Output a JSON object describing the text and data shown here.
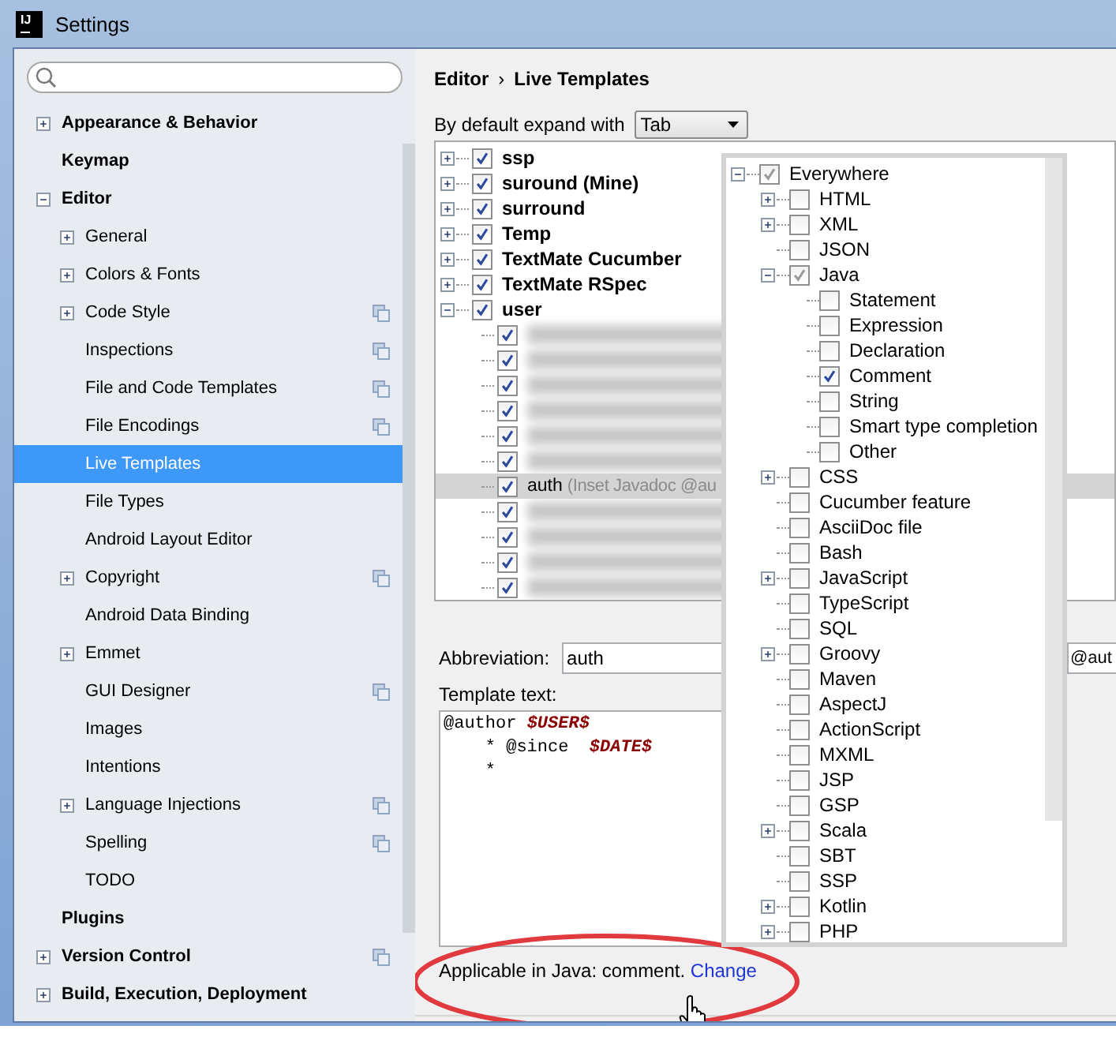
{
  "window": {
    "icon_text": "IJ",
    "title": "Settings"
  },
  "sidebar": {
    "items": [
      {
        "label": "Appearance & Behavior",
        "expanded": false,
        "selected": false,
        "project_level": false
      },
      {
        "label": "Keymap",
        "selected": false,
        "project_level": false
      },
      {
        "label": "Editor",
        "expanded": true,
        "selected": false,
        "project_level": false,
        "children": [
          {
            "label": "General",
            "expanded": false,
            "selected": false,
            "project_level": false
          },
          {
            "label": "Colors & Fonts",
            "expanded": false,
            "selected": false,
            "project_level": false
          },
          {
            "label": "Code Style",
            "expanded": false,
            "selected": false,
            "project_level": true
          },
          {
            "label": "Inspections",
            "selected": false,
            "project_level": true
          },
          {
            "label": "File and Code Templates",
            "selected": false,
            "project_level": true
          },
          {
            "label": "File Encodings",
            "selected": false,
            "project_level": true
          },
          {
            "label": "Live Templates",
            "selected": true,
            "project_level": false
          },
          {
            "label": "File Types",
            "selected": false,
            "project_level": false
          },
          {
            "label": "Android Layout Editor",
            "selected": false,
            "project_level": false
          },
          {
            "label": "Copyright",
            "expanded": false,
            "selected": false,
            "project_level": true
          },
          {
            "label": "Android Data Binding",
            "selected": false,
            "project_level": false
          },
          {
            "label": "Emmet",
            "expanded": false,
            "selected": false,
            "project_level": false
          },
          {
            "label": "GUI Designer",
            "selected": false,
            "project_level": true
          },
          {
            "label": "Images",
            "selected": false,
            "project_level": false
          },
          {
            "label": "Intentions",
            "selected": false,
            "project_level": false
          },
          {
            "label": "Language Injections",
            "expanded": false,
            "selected": false,
            "project_level": true
          },
          {
            "label": "Spelling",
            "selected": false,
            "project_level": true
          },
          {
            "label": "TODO",
            "selected": false,
            "project_level": false
          }
        ]
      },
      {
        "label": "Plugins",
        "selected": false,
        "project_level": false
      },
      {
        "label": "Version Control",
        "expanded": false,
        "selected": false,
        "project_level": true
      },
      {
        "label": "Build, Execution, Deployment",
        "expanded": false,
        "selected": false,
        "project_level": false
      }
    ]
  },
  "breadcrumb": {
    "items": [
      "Editor",
      "Live Templates"
    ],
    "separator": "›"
  },
  "expand_with": {
    "label": "By default expand with",
    "value": "Tab"
  },
  "template_groups": [
    {
      "name": "ssp",
      "checked": true,
      "expanded": false
    },
    {
      "name": "suround (Mine)",
      "checked": true,
      "expanded": false
    },
    {
      "name": "surround",
      "checked": true,
      "expanded": false
    },
    {
      "name": "Temp",
      "checked": true,
      "expanded": false
    },
    {
      "name": "TextMate Cucumber",
      "checked": true,
      "expanded": false
    },
    {
      "name": "TextMate RSpec",
      "checked": true,
      "expanded": false
    },
    {
      "name": "user",
      "checked": true,
      "expanded": true,
      "children": [
        {
          "kind": "blurred",
          "checked": true,
          "selected": false
        },
        {
          "kind": "blurred",
          "checked": true,
          "selected": false
        },
        {
          "kind": "blurred",
          "checked": true,
          "selected": false
        },
        {
          "kind": "blurred",
          "checked": true,
          "selected": false
        },
        {
          "kind": "blurred",
          "checked": true,
          "selected": false
        },
        {
          "kind": "blurred",
          "checked": true,
          "selected": false
        },
        {
          "kind": "template",
          "abbreviation": "auth",
          "description": "(Inset Javadoc @au",
          "checked": true,
          "selected": true
        },
        {
          "kind": "blurred",
          "checked": true,
          "selected": false
        },
        {
          "kind": "blurred",
          "checked": true,
          "selected": false
        },
        {
          "kind": "blurred",
          "checked": true,
          "selected": false
        },
        {
          "kind": "blurred",
          "checked": true,
          "selected": false
        }
      ]
    }
  ],
  "abbreviation": {
    "label": "Abbreviation:",
    "value": "auth"
  },
  "description_field": {
    "value": "@aut"
  },
  "template_text": {
    "label": "Template text:",
    "lines": [
      [
        {
          "kind": "plain",
          "text": "@author "
        },
        {
          "kind": "variable",
          "text": "$USER$"
        }
      ],
      [
        {
          "kind": "plain",
          "text": "    * @since  "
        },
        {
          "kind": "variable",
          "text": "$DATE$"
        }
      ],
      [
        {
          "kind": "plain",
          "text": "    *"
        }
      ]
    ]
  },
  "applicable": {
    "text": "Applicable in Java: comment.",
    "link": "Change"
  },
  "contexts": [
    {
      "name": "Everywhere",
      "checked": true,
      "disabled": true,
      "expanded": true,
      "children": [
        {
          "name": "HTML",
          "checked": false,
          "disabled": false,
          "expanded": false
        },
        {
          "name": "XML",
          "checked": false,
          "disabled": false,
          "expanded": false
        },
        {
          "name": "JSON",
          "checked": false,
          "disabled": false
        },
        {
          "name": "Java",
          "checked": true,
          "disabled": true,
          "expanded": true,
          "children": [
            {
              "name": "Statement",
              "checked": false,
              "disabled": false
            },
            {
              "name": "Expression",
              "checked": false,
              "disabled": false
            },
            {
              "name": "Declaration",
              "checked": false,
              "disabled": false
            },
            {
              "name": "Comment",
              "checked": true,
              "disabled": false
            },
            {
              "name": "String",
              "checked": false,
              "disabled": false
            },
            {
              "name": "Smart type completion",
              "checked": false,
              "disabled": false
            },
            {
              "name": "Other",
              "checked": false,
              "disabled": false
            }
          ]
        },
        {
          "name": "CSS",
          "checked": false,
          "disabled": false,
          "expanded": false
        },
        {
          "name": "Cucumber feature",
          "checked": false,
          "disabled": false
        },
        {
          "name": "AsciiDoc file",
          "checked": false,
          "disabled": false
        },
        {
          "name": "Bash",
          "checked": false,
          "disabled": false
        },
        {
          "name": "JavaScript",
          "checked": false,
          "disabled": false,
          "expanded": false
        },
        {
          "name": "TypeScript",
          "checked": false,
          "disabled": false
        },
        {
          "name": "SQL",
          "checked": false,
          "disabled": false
        },
        {
          "name": "Groovy",
          "checked": false,
          "disabled": false,
          "expanded": false
        },
        {
          "name": "Maven",
          "checked": false,
          "disabled": false
        },
        {
          "name": "AspectJ",
          "checked": false,
          "disabled": false
        },
        {
          "name": "ActionScript",
          "checked": false,
          "disabled": false
        },
        {
          "name": "MXML",
          "checked": false,
          "disabled": false
        },
        {
          "name": "JSP",
          "checked": false,
          "disabled": false
        },
        {
          "name": "GSP",
          "checked": false,
          "disabled": false
        },
        {
          "name": "Scala",
          "checked": false,
          "disabled": false,
          "expanded": false
        },
        {
          "name": "SBT",
          "checked": false,
          "disabled": false
        },
        {
          "name": "SSP",
          "checked": false,
          "disabled": false
        },
        {
          "name": "Kotlin",
          "checked": false,
          "disabled": false,
          "expanded": false
        },
        {
          "name": "PHP",
          "checked": false,
          "disabled": false,
          "expanded": false
        }
      ]
    }
  ]
}
